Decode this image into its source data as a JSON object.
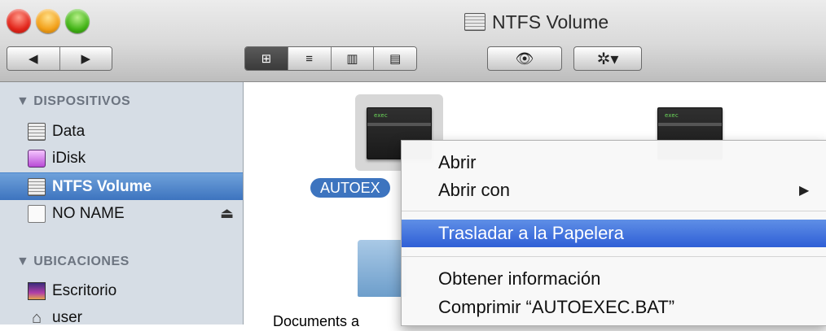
{
  "window": {
    "title": "NTFS Volume"
  },
  "toolbar": {
    "back_icon": "◀",
    "forward_icon": "▶",
    "view_icons": [
      "⊞",
      "≡",
      "▥",
      "▤"
    ],
    "quicklook_icon": "👁",
    "action_icon": "✲▾"
  },
  "sidebar": {
    "sections": [
      {
        "heading": "▼ DISPOSITIVOS"
      },
      {
        "heading": "▼ UBICACIONES"
      }
    ],
    "devices": [
      {
        "label": "Data",
        "icon": "drive-icon"
      },
      {
        "label": "iDisk",
        "icon": "idisk-icon"
      },
      {
        "label": "NTFS Volume",
        "icon": "drive-icon",
        "selected": true
      },
      {
        "label": "NO NAME",
        "icon": "removable-icon",
        "eject": "⏏"
      }
    ],
    "places": [
      {
        "label": "Escritorio",
        "icon": "desktop-icon"
      },
      {
        "label": "user",
        "icon": "home-icon"
      }
    ]
  },
  "files": [
    {
      "label": "AUTOEX",
      "selected": true,
      "exec_text": "exec"
    },
    {
      "label": "",
      "exec_text": "exec"
    },
    {
      "label": "Documents a"
    }
  ],
  "context_menu": {
    "items": [
      {
        "label": "Abrir"
      },
      {
        "label": "Abrir con",
        "submenu": "▶"
      },
      {
        "label": "Trasladar a la Papelera",
        "highlighted": true
      },
      {
        "label": "Obtener información"
      },
      {
        "label": "Comprimir “AUTOEXEC.BAT”"
      }
    ]
  },
  "colors": {
    "selection_blue": "#3d74bf",
    "menu_highlight": "#2f5fd6",
    "sidebar_bg": "#d6dde5"
  }
}
